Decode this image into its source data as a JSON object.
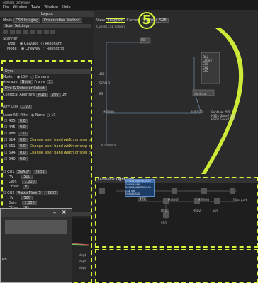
{
  "app": {
    "window_title": "cellSens Dimension",
    "menu": [
      "File",
      "Window",
      "Tools",
      "Window",
      "Help"
    ],
    "layout_label": "Layout"
  },
  "left_panel": {
    "top_rows": {
      "mode_label": "Mode",
      "mode_value": "CSB Imaging",
      "observation_label": "Observation Method",
      "scan_settings": "Scan Settings"
    },
    "scanner": {
      "title": "Scanner",
      "type_label": "Type",
      "type_options": [
        "Galvano",
        "Resonant"
      ],
      "mode_label": "Mode",
      "mode_options": [
        "OneWay",
        "Roundtrip"
      ]
    },
    "dye_section": {
      "title": "Dyes",
      "mode_label": "Mode",
      "mode_options": [
        "LSM",
        "Camera"
      ],
      "average_label": "Average",
      "average_value": "None",
      "frame_label": "Frame",
      "frame_value": "1",
      "dye_detector_button": "Dye & Detector Select",
      "pinhole_label": "Confocal Aperture",
      "pinhole_value": "Auto",
      "pinhole_num": "200",
      "pinhole_unit": "µm",
      "airy_label": "Airy Disk",
      "airy_value": "1.00"
    },
    "laser": {
      "title": "Laser ND Filter",
      "none_label": "None",
      "value_10": "10",
      "lasers": [
        {
          "name": "405",
          "value": "0.0",
          "enabled": false
        },
        {
          "name": "445",
          "value": "0.0",
          "enabled": false
        },
        {
          "name": "488",
          "value": "7.0",
          "enabled": true
        },
        {
          "name": "514",
          "value": "0.0",
          "enabled": false
        },
        {
          "name": "561",
          "value": "0.0",
          "enabled": true
        },
        {
          "name": "594",
          "value": "0.0",
          "enabled": false
        },
        {
          "name": "640",
          "value": "0.0",
          "enabled": false
        }
      ],
      "warning_text": "Change laser band width or step o"
    },
    "channels": [
      {
        "name": "CH1",
        "detector": "GaAsP",
        "dye": "HSD1",
        "voltage_label": "HV",
        "voltage": "500",
        "gain_label": "Gain",
        "gain": "1.000",
        "offset_label": "Offset",
        "offset": "0"
      },
      {
        "name": "CH2",
        "detector": "Alexa Fluor 5",
        "dye": "HSD2",
        "voltage_label": "HV",
        "voltage": "500",
        "gain_label": "Gain",
        "gain": "1.000",
        "offset_label": "Offset",
        "offset": "0"
      }
    ],
    "contrast_title": "Contrast Setting"
  },
  "graph": {
    "view_label": "View",
    "view_value": "Diagram",
    "camera_label": "Camera",
    "camera_value": "Camera_SR8",
    "current_label": "Current CSB Camera",
    "nodes": {
      "top": "PD",
      "wavelength_405": "405",
      "bs": "BS",
      "scan_r_label": "SCAN R",
      "mirror1": "MIRROR",
      "mirror2": "MIRROR",
      "to_camera": "To Camera",
      "confocal": "Confocal",
      "detector_box": [
        "Obj",
        "Lasers",
        "CH1",
        "CH2",
        "CH3"
      ],
      "confocal_pinhole": "Confocal PMT",
      "hsd_labels": [
        "HSD1 GaAsP 500",
        "HSD2 GaAsP 500"
      ],
      "dm_labels": [
        "DM",
        "DM"
      ]
    }
  },
  "lower_panel": {
    "tabs": [
      "Overview",
      "Light Path"
    ],
    "dichroic_options": [
      "DM405/488/561/640",
      "DM405/488",
      "DM405/488/561/640 CSB set",
      "DM440/520"
    ],
    "dichroic_selected": "DM405/488/561/640",
    "numeric_value": "473",
    "nodes": [
      "MIRROR",
      "MIRROR",
      "Fiber port",
      "HSD1",
      "HSD2",
      "SD1",
      "SD2",
      "MIRROR",
      "MIRROR"
    ]
  },
  "popup": {
    "close_glyph": "×",
    "min_glyph": "–",
    "side_text": "es"
  },
  "right_bottom": {
    "items": [
      "dept",
      "dept",
      "dept"
    ]
  },
  "annotation": {
    "callout_number": "5",
    "accent": "#d7f43a"
  }
}
